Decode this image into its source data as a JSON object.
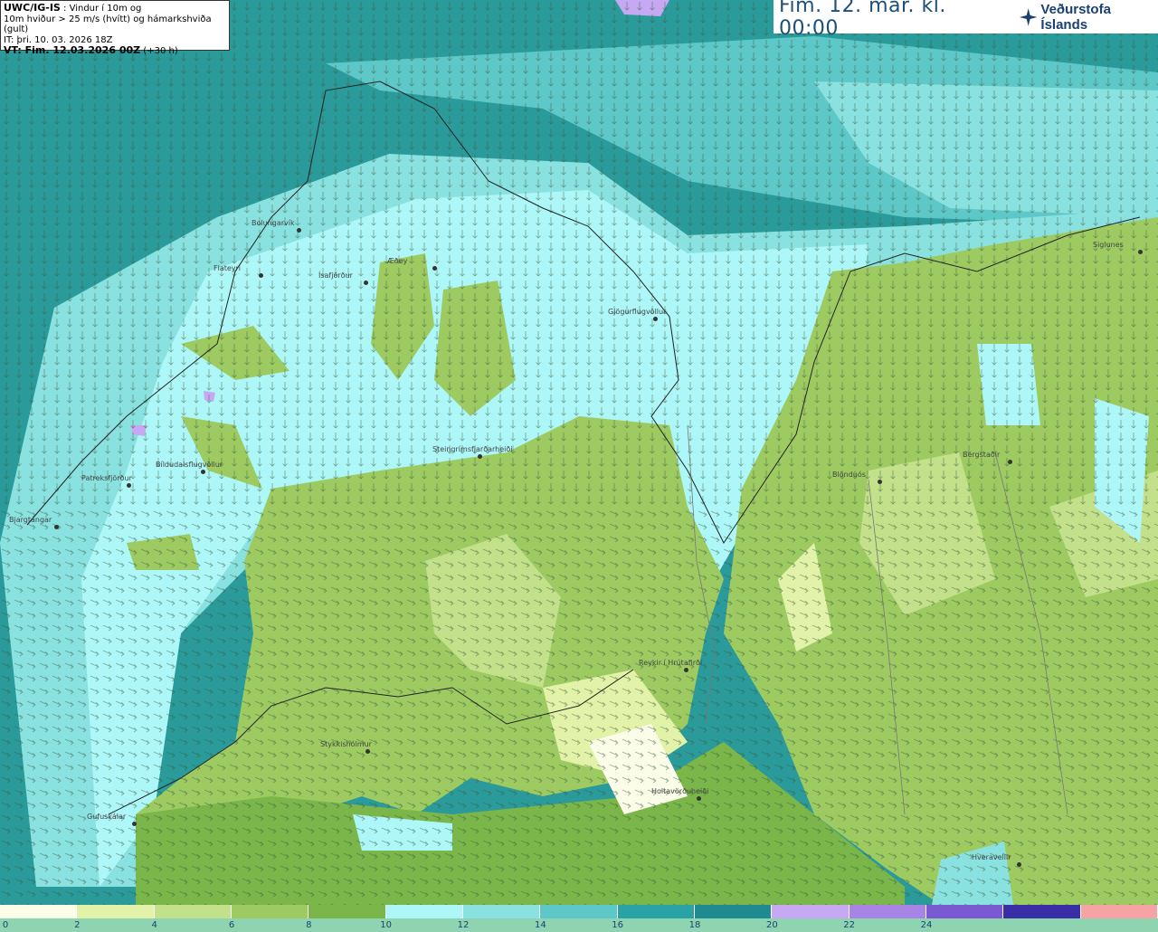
{
  "info": {
    "model": "UWC/IG-IS",
    "desc1": ": Vindur í 10m og",
    "desc2": "10m hviður > 25 m/s (hvítt) og hámarkshviða (gult)",
    "it_line": "IT: þri. 10. 03. 2026 18Z",
    "vt_line": "VT: Fim. 12.03.2026 00Z",
    "vt_offset": "(+30 h)"
  },
  "title": {
    "time": "Fim. 12. mar. kl. 00:00",
    "logo_text": "Veðurstofa Íslands",
    "logo_icon": "vedurstofa-logo-icon"
  },
  "legend": {
    "colors": [
      "#fbfde8",
      "#e2f2a8",
      "#c3e08a",
      "#9dcb62",
      "#7ab64a",
      "#aef7f8",
      "#8ae2e0",
      "#5ec7c8",
      "#2aa3a6",
      "#1f8b90",
      "#c6a9f2",
      "#a784e6",
      "#7a5ad2",
      "#3a2ea6",
      "#f7a3a6"
    ],
    "labels": [
      "0",
      "2",
      "4",
      "6",
      "8",
      "10",
      "12",
      "14",
      "16",
      "18",
      "20",
      "22",
      "24"
    ]
  },
  "places": [
    {
      "name": "Bolungarvík"
    },
    {
      "name": "Flateyri"
    },
    {
      "name": "Ísafjörður"
    },
    {
      "name": "Æðey"
    },
    {
      "name": "Gjögurflugvöllur"
    },
    {
      "name": "Siglunes"
    },
    {
      "name": "Steingrímsfjarðarheiði"
    },
    {
      "name": "Blönduós"
    },
    {
      "name": "Bergstaðir"
    },
    {
      "name": "Bíldudalsflugvöllur"
    },
    {
      "name": "Patreksfjörður"
    },
    {
      "name": "Bjargtangar"
    },
    {
      "name": "Reykir í Hrútafirði"
    },
    {
      "name": "Stykkishólmur"
    },
    {
      "name": "Holtavörðuheiði"
    },
    {
      "name": "Gufuskálar"
    },
    {
      "name": "Hveravellir"
    }
  ]
}
